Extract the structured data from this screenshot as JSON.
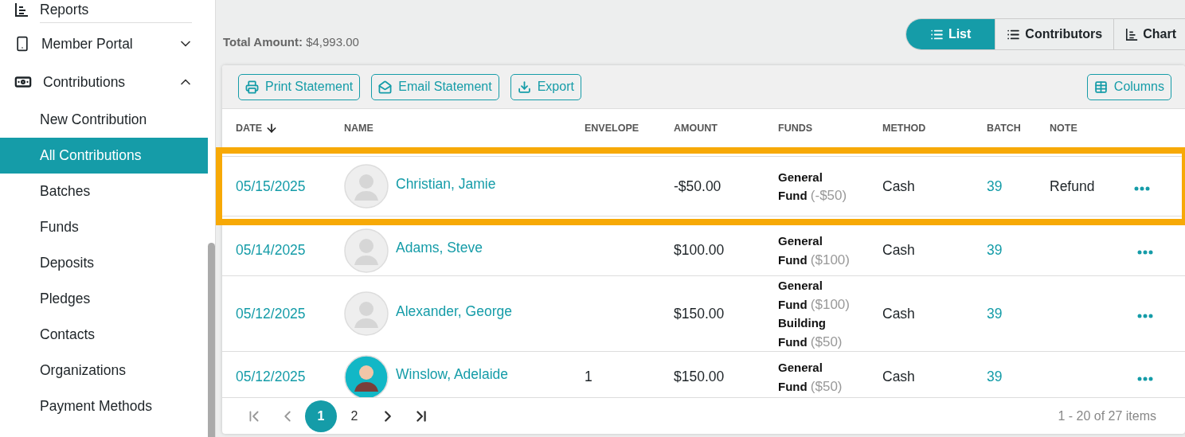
{
  "sidebar": {
    "items": [
      {
        "label": "Reports"
      },
      {
        "label": "Member Portal",
        "expanded": false
      },
      {
        "label": "Contributions",
        "expanded": true,
        "children": [
          {
            "label": "New Contribution",
            "selected": false
          },
          {
            "label": "All Contributions",
            "selected": true
          },
          {
            "label": "Batches",
            "selected": false
          },
          {
            "label": "Funds",
            "selected": false
          },
          {
            "label": "Deposits",
            "selected": false
          },
          {
            "label": "Pledges",
            "selected": false
          },
          {
            "label": "Contacts",
            "selected": false
          },
          {
            "label": "Organizations",
            "selected": false
          },
          {
            "label": "Payment Methods",
            "selected": false
          }
        ]
      }
    ]
  },
  "total": {
    "label": "Total Amount:",
    "value": "$4,993.00"
  },
  "view_toggle": [
    {
      "label": "List",
      "selected": true
    },
    {
      "label": "Contributors",
      "selected": false
    },
    {
      "label": "Chart",
      "selected": false
    }
  ],
  "toolbar": {
    "buttons": [
      "Print Statement",
      "Email Statement",
      "Export"
    ],
    "columns_button": "Columns"
  },
  "table": {
    "columns": [
      {
        "label": "DATE",
        "sorted_descending": true
      },
      {
        "label": "NAME"
      },
      {
        "label": "ENVELOPE"
      },
      {
        "label": "AMOUNT"
      },
      {
        "label": "FUNDS"
      },
      {
        "label": "METHOD"
      },
      {
        "label": "BATCH"
      },
      {
        "label": "NOTE"
      }
    ],
    "rows": [
      {
        "date": "05/15/2025",
        "name": "Christian, Jamie",
        "avatar_custom": false,
        "envelope": "",
        "amount": "-$50.00",
        "funds": [
          {
            "name": "General Fund",
            "amount": "(-$50)"
          }
        ],
        "method": "Cash",
        "batch": "39",
        "note": "Refund",
        "highlighted": true
      },
      {
        "date": "05/14/2025",
        "name": "Adams, Steve",
        "avatar_custom": false,
        "envelope": "",
        "amount": "$100.00",
        "funds": [
          {
            "name": "General Fund",
            "amount": "($100)"
          }
        ],
        "method": "Cash",
        "batch": "39",
        "note": "",
        "highlighted": false
      },
      {
        "date": "05/12/2025",
        "name": "Alexander, George",
        "avatar_custom": false,
        "envelope": "",
        "amount": "$150.00",
        "funds": [
          {
            "name": "General Fund",
            "amount": "($100)"
          },
          {
            "name": "Building Fund",
            "amount": "($50)"
          }
        ],
        "method": "Cash",
        "batch": "39",
        "note": "",
        "highlighted": false
      },
      {
        "date": "05/12/2025",
        "name": "Winslow, Adelaide",
        "avatar_custom": true,
        "envelope": "1",
        "amount": "$150.00",
        "funds": [
          {
            "name": "General Fund",
            "amount": "($50)"
          }
        ],
        "method": "Cash",
        "batch": "39",
        "note": "",
        "highlighted": false
      }
    ]
  },
  "pager": {
    "first_disabled": true,
    "prev_disabled": true,
    "pages": [
      {
        "label": "1",
        "selected": true
      },
      {
        "label": "2",
        "selected": false
      }
    ],
    "summary": "1 - 20 of 27 items"
  }
}
